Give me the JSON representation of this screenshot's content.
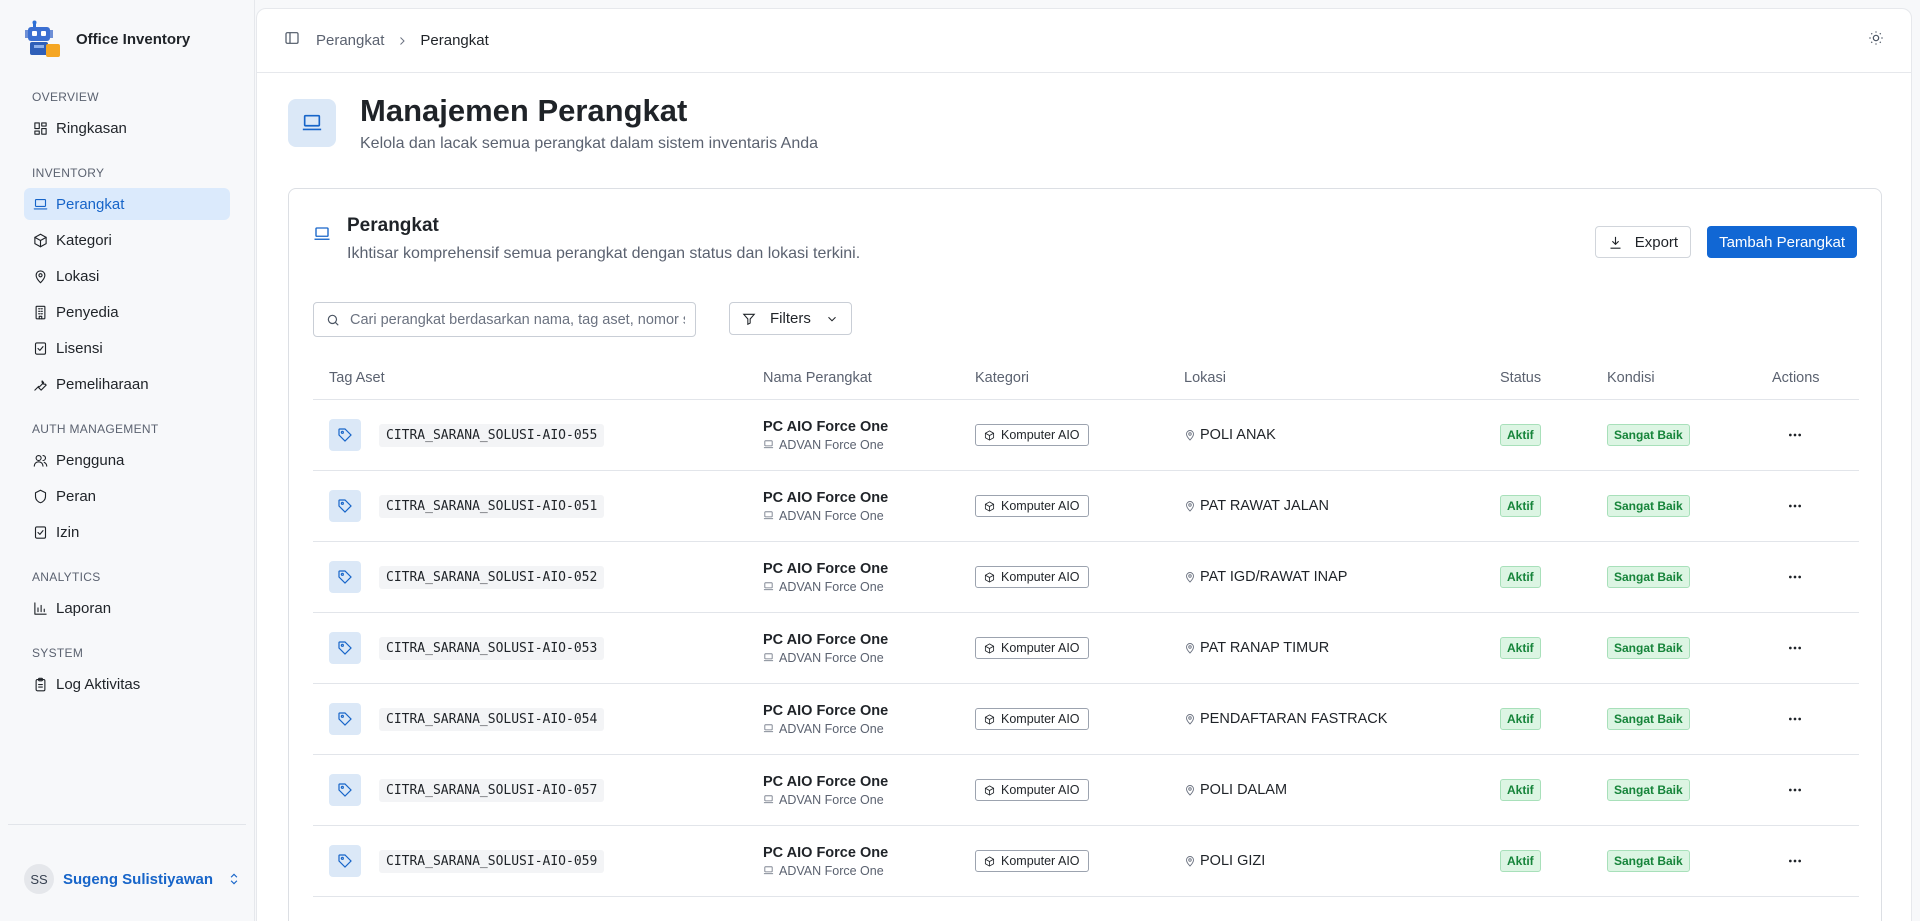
{
  "app": {
    "title": "Office Inventory"
  },
  "sidebar": {
    "sections": [
      {
        "label": "OVERVIEW",
        "items": [
          {
            "label": "Ringkasan",
            "icon": "dashboard-icon"
          }
        ]
      },
      {
        "label": "INVENTORY",
        "items": [
          {
            "label": "Perangkat",
            "icon": "laptop-icon",
            "active": true
          },
          {
            "label": "Kategori",
            "icon": "package-icon"
          },
          {
            "label": "Lokasi",
            "icon": "map-pin-icon"
          },
          {
            "label": "Penyedia",
            "icon": "building-icon"
          },
          {
            "label": "Lisensi",
            "icon": "file-check-icon"
          },
          {
            "label": "Pemeliharaan",
            "icon": "wrench-icon"
          }
        ]
      },
      {
        "label": "AUTH MANAGEMENT",
        "items": [
          {
            "label": "Pengguna",
            "icon": "users-icon"
          },
          {
            "label": "Peran",
            "icon": "shield-icon"
          },
          {
            "label": "Izin",
            "icon": "file-check-icon"
          }
        ]
      },
      {
        "label": "ANALYTICS",
        "items": [
          {
            "label": "Laporan",
            "icon": "bar-chart-icon"
          }
        ]
      },
      {
        "label": "SYSTEM",
        "items": [
          {
            "label": "Log Aktivitas",
            "icon": "clipboard-icon"
          }
        ]
      }
    ],
    "user": {
      "initials": "SS",
      "name": "Sugeng Sulistiyawan"
    }
  },
  "breadcrumb": {
    "parent": "Perangkat",
    "current": "Perangkat"
  },
  "page": {
    "title": "Manajemen Perangkat",
    "subtitle": "Kelola dan lacak semua perangkat dalam sistem inventaris Anda"
  },
  "card": {
    "title": "Perangkat",
    "subtitle": "Ikhtisar komprehensif semua perangkat dengan status dan lokasi terkini.",
    "export_label": "Export",
    "add_label": "Tambah Perangkat",
    "search_placeholder": "Cari perangkat berdasarkan nama, tag aset, nomor seri...",
    "filters_label": "Filters"
  },
  "table": {
    "headers": [
      "Tag Aset",
      "Nama Perangkat",
      "Kategori",
      "Lokasi",
      "Status",
      "Kondisi",
      "Actions"
    ],
    "rows": [
      {
        "tag": "CITRA_SARANA_SOLUSI-AIO-055",
        "name": "PC AIO Force One",
        "model": "ADVAN Force One",
        "category": "Komputer AIO",
        "location": "POLI ANAK",
        "status": "Aktif",
        "condition": "Sangat Baik"
      },
      {
        "tag": "CITRA_SARANA_SOLUSI-AIO-051",
        "name": "PC AIO Force One",
        "model": "ADVAN Force One",
        "category": "Komputer AIO",
        "location": "PAT RAWAT JALAN",
        "status": "Aktif",
        "condition": "Sangat Baik"
      },
      {
        "tag": "CITRA_SARANA_SOLUSI-AIO-052",
        "name": "PC AIO Force One",
        "model": "ADVAN Force One",
        "category": "Komputer AIO",
        "location": "PAT IGD/RAWAT INAP",
        "status": "Aktif",
        "condition": "Sangat Baik"
      },
      {
        "tag": "CITRA_SARANA_SOLUSI-AIO-053",
        "name": "PC AIO Force One",
        "model": "ADVAN Force One",
        "category": "Komputer AIO",
        "location": "PAT RANAP TIMUR",
        "status": "Aktif",
        "condition": "Sangat Baik"
      },
      {
        "tag": "CITRA_SARANA_SOLUSI-AIO-054",
        "name": "PC AIO Force One",
        "model": "ADVAN Force One",
        "category": "Komputer AIO",
        "location": "PENDAFTARAN FASTRACK",
        "status": "Aktif",
        "condition": "Sangat Baik"
      },
      {
        "tag": "CITRA_SARANA_SOLUSI-AIO-057",
        "name": "PC AIO Force One",
        "model": "ADVAN Force One",
        "category": "Komputer AIO",
        "location": "POLI DALAM",
        "status": "Aktif",
        "condition": "Sangat Baik"
      },
      {
        "tag": "CITRA_SARANA_SOLUSI-AIO-059",
        "name": "PC AIO Force One",
        "model": "ADVAN Force One",
        "category": "Komputer AIO",
        "location": "POLI GIZI",
        "status": "Aktif",
        "condition": "Sangat Baik"
      }
    ]
  },
  "colors": {
    "accent": "#1167d4",
    "active_bg": "#dbeafc",
    "success": "#16843a"
  }
}
